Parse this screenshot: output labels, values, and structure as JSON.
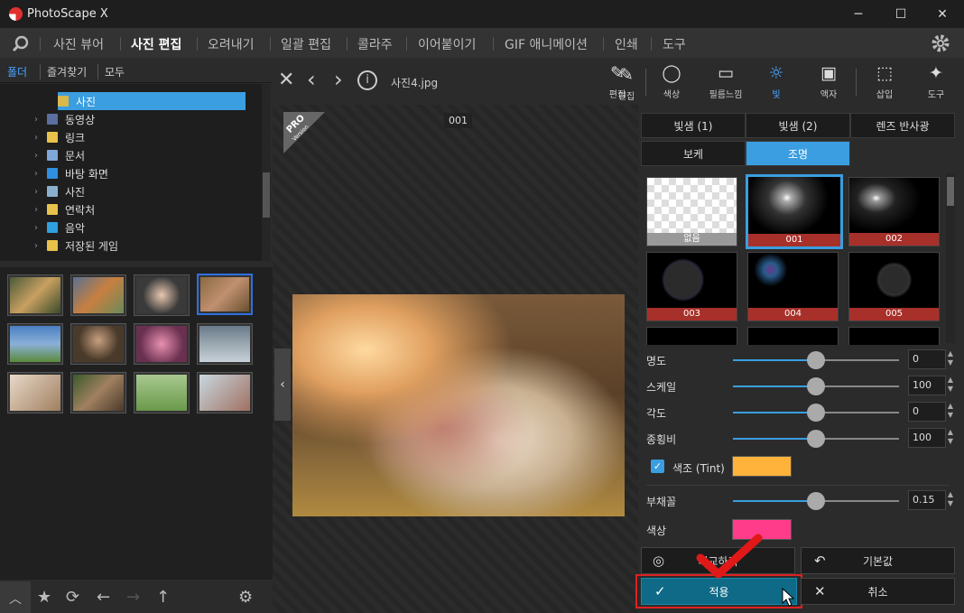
{
  "app": {
    "title": "PhotoScape X"
  },
  "window": {
    "minimize_icon": "─",
    "maximize_icon": "☐",
    "close_icon": "✕"
  },
  "menu": {
    "items": [
      "사진 뷰어",
      "사진 편집",
      "오려내기",
      "일괄 편집",
      "콜라주",
      "이어붙이기",
      "GIF 애니메이션",
      "인쇄",
      "도구"
    ],
    "active": "사진 편집"
  },
  "left": {
    "tabs": [
      "폴더",
      "즐겨찾기",
      "모두"
    ],
    "tree": [
      {
        "label": "사진",
        "selected": true,
        "color": "#d8b84a"
      },
      {
        "label": "동영상",
        "color": "#5a6fa0"
      },
      {
        "label": "링크",
        "color": "#e8c24a"
      },
      {
        "label": "문서",
        "color": "#7fa7d8"
      },
      {
        "label": "바탕 화면",
        "color": "#2f8fe0"
      },
      {
        "label": "사진",
        "color": "#8ab0d0"
      },
      {
        "label": "연락처",
        "color": "#e8c24a"
      },
      {
        "label": "음악",
        "color": "#2fa0e0"
      },
      {
        "label": "저장된 게임",
        "color": "#e8c24a"
      }
    ],
    "bottom_icons": [
      "chevron-up-icon",
      "star-icon",
      "refresh-icon",
      "arrow-left-icon",
      "arrow-right-icon",
      "arrow-up-icon",
      "gear-icon"
    ]
  },
  "center": {
    "filename": "사진4.jpg",
    "overlay_label": "001",
    "pro_badge": "PRO",
    "pro_sub": "Version"
  },
  "right": {
    "tools": [
      {
        "label": "편집",
        "icon": "edit-icon"
      },
      {
        "label": "색상",
        "icon": "color-icon"
      },
      {
        "label": "필름느낌",
        "icon": "film-icon"
      },
      {
        "label": "빛",
        "icon": "light-icon",
        "active": true
      },
      {
        "label": "액자",
        "icon": "frame-icon"
      },
      {
        "label": "삽입",
        "icon": "insert-icon"
      },
      {
        "label": "도구",
        "icon": "tools-icon"
      }
    ],
    "tabs_row1": [
      "빛샘 (1)",
      "빛샘 (2)",
      "렌즈 반사광"
    ],
    "tabs_row2": [
      "보케",
      "조명"
    ],
    "active_tab": "조명",
    "effects": [
      "없음",
      "001",
      "002",
      "003",
      "004",
      "005"
    ],
    "selected_effect": "001",
    "sliders": [
      {
        "label": "명도",
        "value": "0",
        "fraction": 0.5
      },
      {
        "label": "스케일",
        "value": "100",
        "fraction": 0.5
      },
      {
        "label": "각도",
        "value": "0",
        "fraction": 0.5
      },
      {
        "label": "종횡비",
        "value": "100",
        "fraction": 0.5
      }
    ],
    "tint": {
      "label": "색조 (Tint)",
      "checked": true,
      "color": "#ffb33a"
    },
    "fan": {
      "label": "부채꼴",
      "value": "0.15",
      "fraction": 0.5
    },
    "color": {
      "label": "색상",
      "color": "#ff3c8a"
    },
    "buttons": {
      "compare": "비교하기",
      "reset": "기본값",
      "apply": "적용",
      "cancel": "취소"
    }
  }
}
